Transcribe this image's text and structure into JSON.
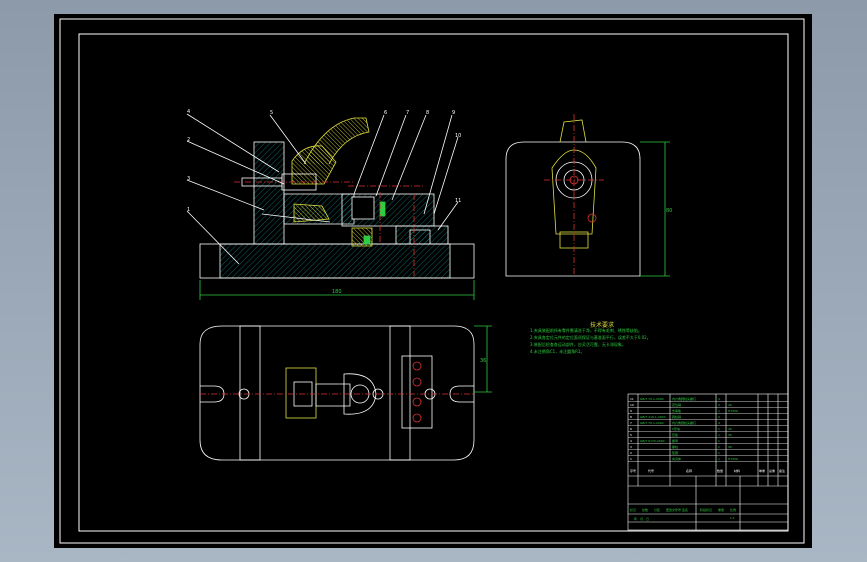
{
  "drawing": {
    "part_numbers": [
      "1",
      "2",
      "3",
      "4",
      "5",
      "6",
      "7",
      "8",
      "9",
      "10",
      "11"
    ],
    "dimensions": {
      "front_width": "180",
      "side_height": "80",
      "top_height": "36"
    },
    "tech_notes_title": "技术要求",
    "tech_notes": [
      "1.夹具装配前所有零件需清洗干净，不得有毛刺、锈蚀等缺陷。",
      "2.夹具各定位元件的定位面须保证与基准面平行，误差不大于0.02。",
      "3.装配后检查各运动部件，应灵活可靠，无卡滞现象。",
      "4.未注倒角C1，未注圆角R1。"
    ],
    "title_block": {
      "col_headers": [
        "序号",
        "代号",
        "名称",
        "数量",
        "材料",
        "单重",
        "总重",
        "备注"
      ],
      "rows": [
        [
          "11",
          "GB/T 70.1-2000",
          "内六角圆柱头螺钉",
          "4",
          "",
          "",
          "",
          ""
        ],
        [
          "10",
          "",
          "定位销",
          "2",
          "45",
          "",
          "",
          ""
        ],
        [
          "9",
          "",
          "支承板",
          "1",
          "HT200",
          "",
          "",
          ""
        ],
        [
          "8",
          "GB/T 119.1-2000",
          "圆柱销",
          "2",
          "",
          "",
          "",
          ""
        ],
        [
          "7",
          "GB/T 70.1-2000",
          "内六角圆柱头螺钉",
          "4",
          "",
          "",
          "",
          ""
        ],
        [
          "6",
          "",
          "V形块",
          "1",
          "45",
          "",
          "",
          ""
        ],
        [
          "5",
          "",
          "压板",
          "1",
          "45",
          "",
          "",
          ""
        ],
        [
          "4",
          "GB/T 6170-2000",
          "螺母",
          "1",
          "",
          "",
          "",
          ""
        ],
        [
          "3",
          "",
          "螺柱",
          "1",
          "45",
          "",
          "",
          ""
        ],
        [
          "2",
          "",
          "垫圈",
          "1",
          "",
          "",
          "",
          ""
        ],
        [
          "1",
          "",
          "夹具体",
          "1",
          "HT200",
          "",
          "",
          ""
        ]
      ],
      "footer_labels": [
        "标记",
        "处数",
        "分区",
        "更改文件号",
        "签名",
        "年、月、日"
      ],
      "stage_labels": [
        "阶段标记",
        "重量",
        "比例"
      ],
      "scale": "1:1"
    }
  }
}
